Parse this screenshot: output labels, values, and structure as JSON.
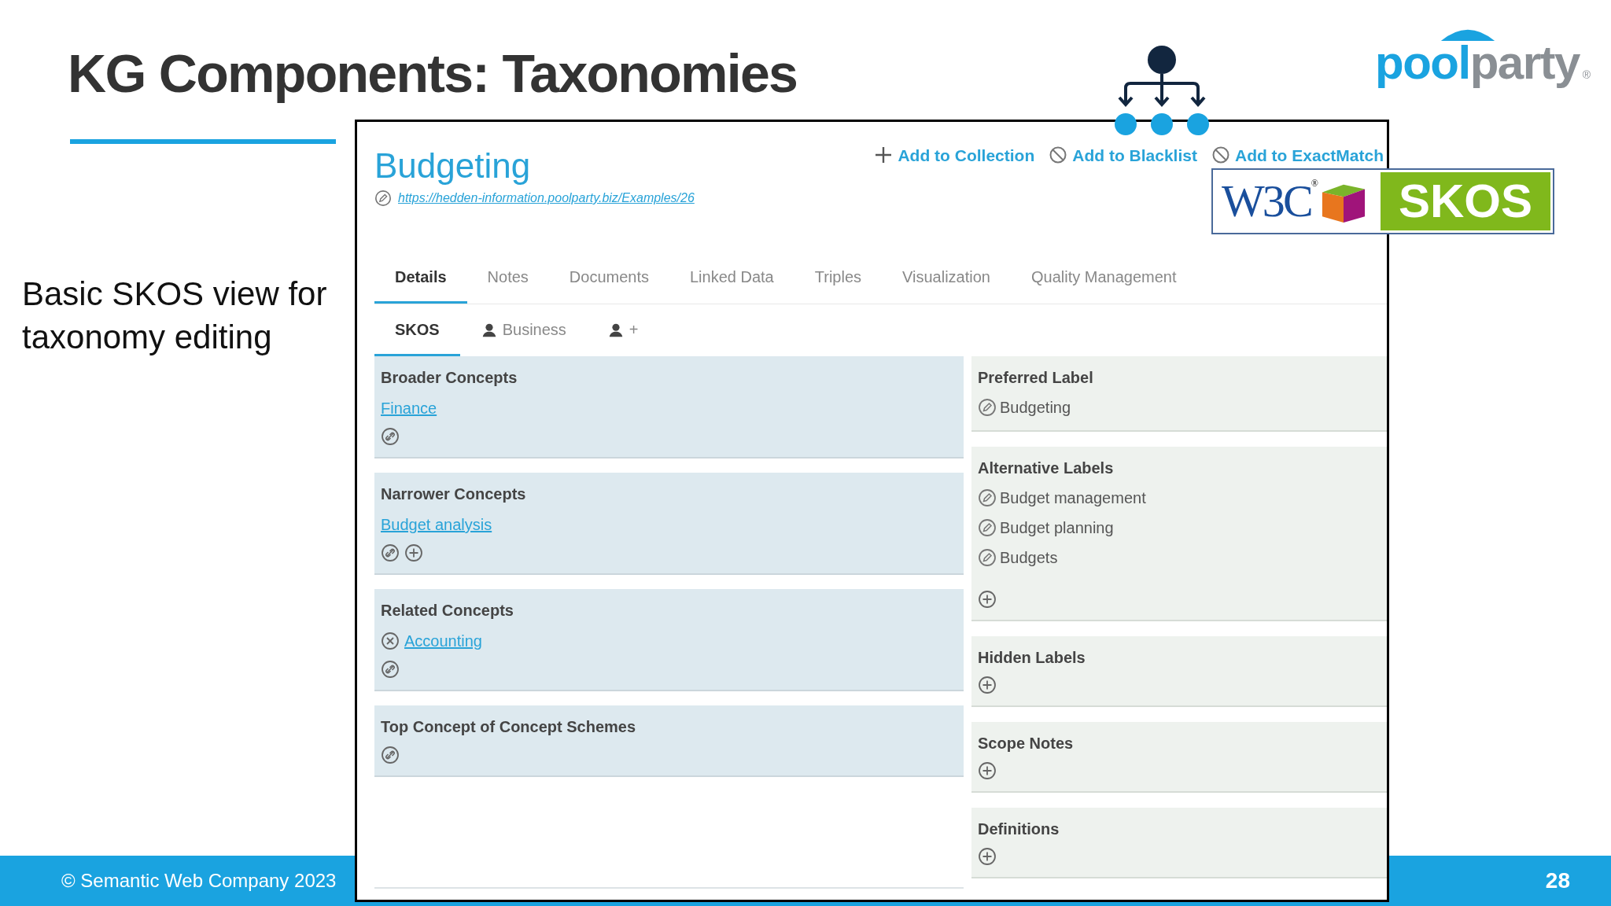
{
  "slide": {
    "title": "KG Components: Taxonomies",
    "body_text": "Basic SKOS view for taxonomy editing",
    "footer": "© Semantic Web Company 2023",
    "page_number": "28"
  },
  "brand_logo": {
    "left": "pool",
    "right": "party",
    "mark": "®"
  },
  "skos_badge": {
    "left": "W3C",
    "mark": "®",
    "right": "SKOS"
  },
  "screen": {
    "concept": {
      "title": "Budgeting",
      "uri": "https://hedden-information.poolparty.biz/Examples/26"
    },
    "actions": [
      {
        "label": "Add to Collection",
        "kind": "add"
      },
      {
        "label": "Add to Blacklist",
        "kind": "block"
      },
      {
        "label": "Add to ExactMatch",
        "kind": "block"
      }
    ],
    "tabs": [
      {
        "label": "Details",
        "selected": true
      },
      {
        "label": "Notes",
        "selected": false
      },
      {
        "label": "Documents",
        "selected": false
      },
      {
        "label": "Linked Data",
        "selected": false
      },
      {
        "label": "Triples",
        "selected": false
      },
      {
        "label": "Visualization",
        "selected": false
      },
      {
        "label": "Quality Management",
        "selected": false
      }
    ],
    "subtabs": [
      {
        "label": "SKOS",
        "kind": "text",
        "selected": true
      },
      {
        "label": "Business",
        "kind": "person",
        "selected": false
      },
      {
        "label": "+",
        "kind": "person",
        "selected": false
      }
    ],
    "left_panels": [
      {
        "title": "Broader Concepts",
        "items": [
          {
            "label": "Finance",
            "kind": "link"
          }
        ],
        "link_button": true
      },
      {
        "title": "Narrower Concepts",
        "items": [
          {
            "label": "Budget analysis",
            "kind": "link"
          }
        ],
        "link_button": true,
        "add_button": true
      },
      {
        "title": "Related Concepts",
        "items": [
          {
            "label": "Accounting",
            "kind": "removable"
          }
        ],
        "link_button": true
      },
      {
        "title": "Top Concept of Concept Schemes",
        "link_button": true
      }
    ],
    "right_panels": [
      {
        "title": "Preferred Label",
        "labels": [
          "Budgeting"
        ]
      },
      {
        "title": "Alternative Labels",
        "labels": [
          "Budget management",
          "Budget planning",
          "Budgets"
        ],
        "add_button": true
      },
      {
        "title": "Hidden Labels",
        "add_button": true
      },
      {
        "title": "Scope Notes",
        "add_button": true
      },
      {
        "title": "Definitions",
        "add_button": true
      }
    ]
  }
}
